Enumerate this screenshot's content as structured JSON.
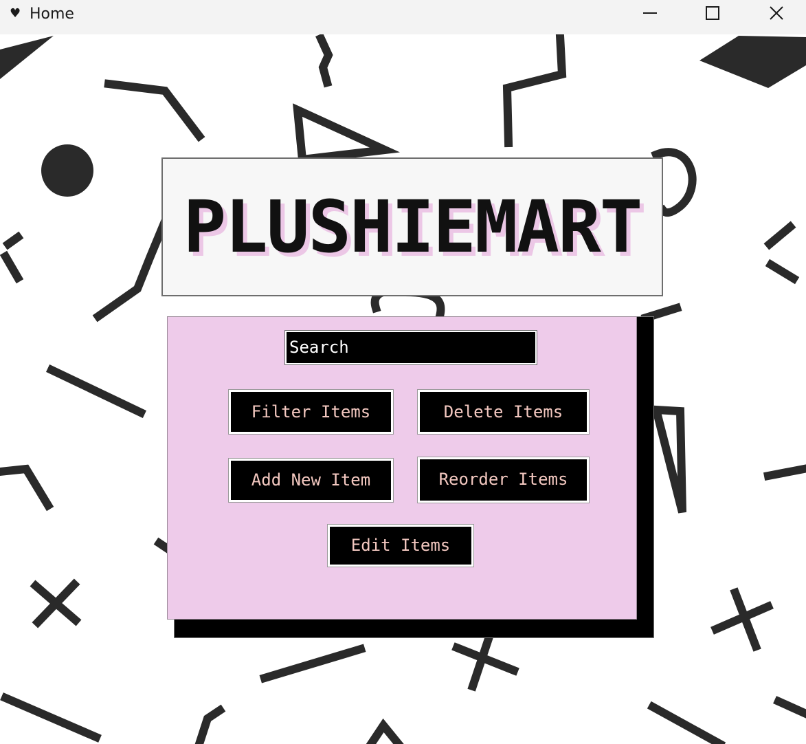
{
  "window": {
    "title": "Home",
    "app_icon": "heart-icon"
  },
  "window_controls": {
    "minimize_icon": "minimize-icon",
    "maximize_icon": "maximize-icon",
    "close_icon": "close-icon"
  },
  "background": {
    "pattern": "memphis geometric shapes",
    "shape_color": "#2a2a2a",
    "base_color": "#ffffff"
  },
  "logo": {
    "text": "PLUSHIEMART",
    "shadow_color": "#ecc7e6"
  },
  "menu": {
    "panel_color": "#eecbea",
    "search": {
      "value": "Search"
    },
    "buttons": {
      "filter": "Filter Items",
      "delete": "Delete Items",
      "add": "Add New Item",
      "reorder": "Reorder Items",
      "edit": "Edit Items"
    },
    "button_text_color": "#f3c8c0"
  }
}
